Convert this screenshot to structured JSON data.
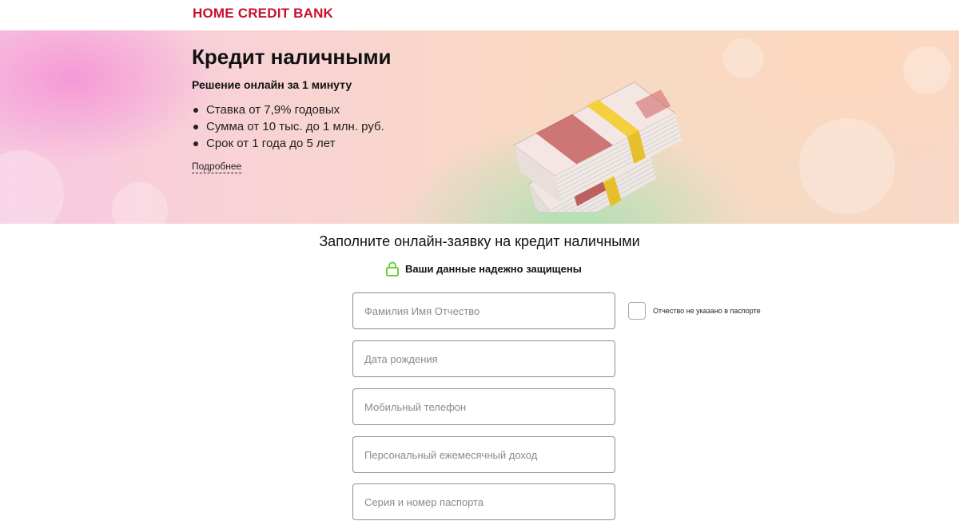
{
  "header": {
    "logo_text": "HOME CREDIT BANK",
    "brand_color": "#c8102e"
  },
  "hero": {
    "title": "Кредит наличными",
    "subtitle": "Решение онлайн за 1 минуту",
    "bullets": [
      "Ставка от 7,9% годовых",
      "Сумма от 10 тыс. до 1 млн. руб.",
      "Срок от 1 года до 5 лет"
    ],
    "more_link": "Подробнее",
    "image_icon": "money-stack-image"
  },
  "form": {
    "title": "Заполните онлайн-заявку на кредит наличными",
    "secure_text": "Ваши данные надежно защищены",
    "secure_icon": "lock-icon",
    "secure_color": "#6fcf3a",
    "fields": {
      "full_name": {
        "placeholder": "Фамилия Имя Отчество",
        "value": ""
      },
      "birth_date": {
        "placeholder": "Дата рождения",
        "value": ""
      },
      "mobile_phone": {
        "placeholder": "Мобильный телефон",
        "value": ""
      },
      "monthly_income": {
        "placeholder": "Персональный ежемесячный доход",
        "value": ""
      },
      "passport": {
        "placeholder": "Серия и номер паспорта",
        "value": ""
      }
    },
    "no_patronymic_checkbox": {
      "label": "Отчество не указано в паспорте",
      "checked": false
    }
  }
}
